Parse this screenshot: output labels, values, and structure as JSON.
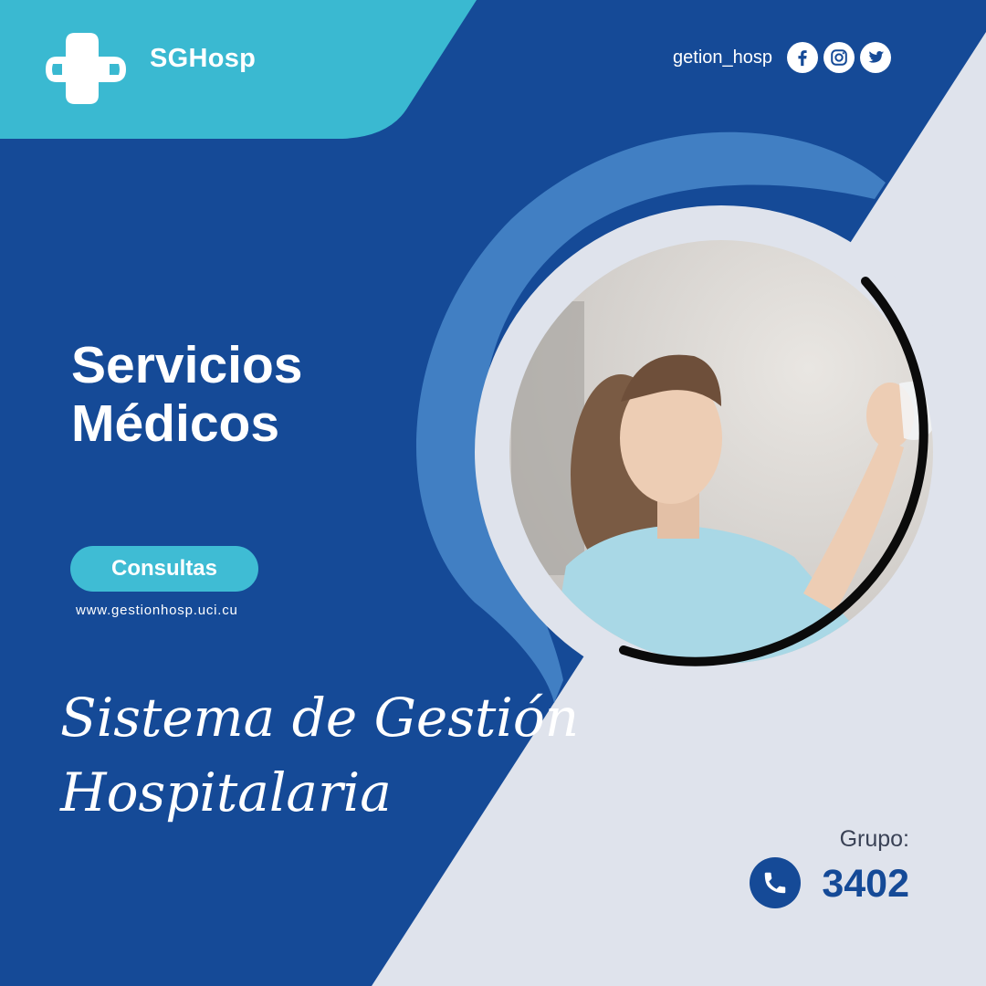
{
  "brand": {
    "name": "SGHosp"
  },
  "social": {
    "handle": "getion_hosp",
    "icons": [
      "facebook-icon",
      "instagram-icon",
      "twitter-icon"
    ]
  },
  "headline": {
    "line1": "Servicios",
    "line2": "Médicos"
  },
  "cta": {
    "label": "Consultas"
  },
  "website": "www.gestionhosp.uci.cu",
  "tagline": {
    "line1": "Sistema de Gestión",
    "line2": "Hospitalaria"
  },
  "group": {
    "label": "Grupo:",
    "number": "3402",
    "icon": "phone-icon"
  },
  "colors": {
    "navy": "#154a97",
    "cyan": "#3fbcd4",
    "light_blue": "#417fc3",
    "background": "#dfe3ec",
    "white": "#ffffff"
  }
}
